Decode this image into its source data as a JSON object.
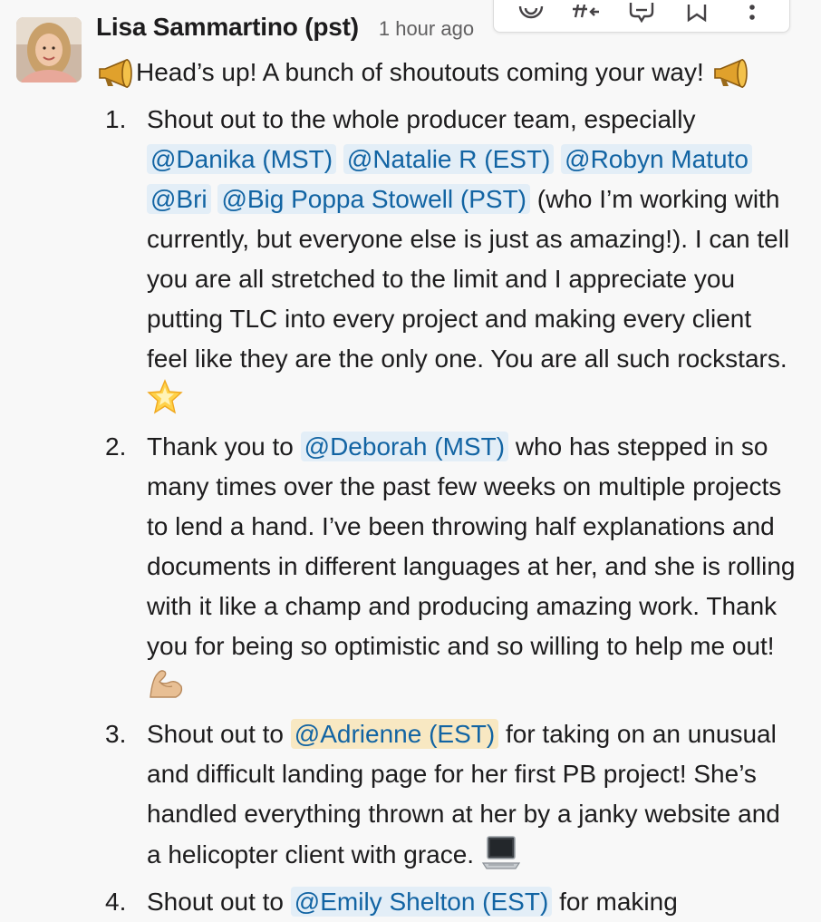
{
  "message": {
    "author": "Lisa Sammartino (pst)",
    "timestamp": "1 hour ago",
    "toolbar_icons": [
      "add-reaction-icon",
      "reply-in-thread-hash-icon",
      "comment-icon",
      "bookmark-icon",
      "more-actions-icon"
    ],
    "intro": "Head’s up! A bunch of shoutouts coming your way!",
    "intro_emoji": "mega-icon",
    "items": [
      {
        "number": "1.",
        "t0": "Shout out to the whole producer team, especially",
        "m1": "@Danika (MST)",
        "m2": "@Natalie R (EST)",
        "m3": "@Robyn Matuto",
        "m4": "@Bri",
        "m5": "@Big Poppa Stowell (PST)",
        "t1": "(who I’m working with currently, but everyone else is just as amazing!). I can tell you are all stretched to the limit and I appreciate you putting TLC into every project and making every client feel like they are the only one. You are all such rockstars.",
        "emoji": "star2-icon"
      },
      {
        "number": "2.",
        "t0": "Thank you to",
        "m1": "@Deborah (MST)",
        "t1": "who has stepped in so many times over the past few weeks on multiple projects to lend a hand. I’ve been throwing half explanations and documents in different languages at her, and she is rolling with it like a champ and producing amazing work. Thank you for being so optimistic and so willing to help me out!",
        "emoji": "muscle-icon"
      },
      {
        "number": "3.",
        "t0": "Shout out to",
        "m1": "@Adrienne (EST)",
        "t1": "for taking on an unusual and difficult landing page for her first PB project! She’s handled everything thrown at her by a janky website and a helicopter client with grace.",
        "emoji": "laptop-icon"
      },
      {
        "number": "4.",
        "t0": "Shout out to",
        "m1": "@Emily Shelton (EST)",
        "t1": "for making"
      }
    ]
  }
}
